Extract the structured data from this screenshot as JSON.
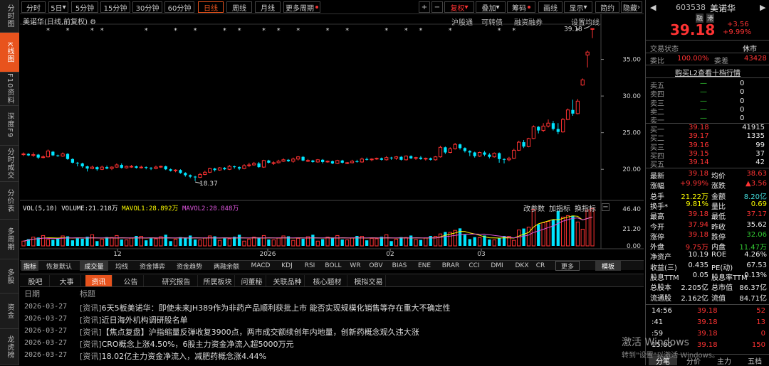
{
  "stock": {
    "code": "603538",
    "name": "美诺华",
    "tags": [
      "融",
      "港"
    ],
    "price": "39.18",
    "change": "+3.56",
    "pct": "+9.99%",
    "status_label": "交易状态",
    "status": "休市"
  },
  "sidebar": [
    {
      "label": "分时图",
      "active": false
    },
    {
      "label": "K线图",
      "active": true
    },
    {
      "label": "F10资料",
      "active": false
    },
    {
      "label": "深度F9",
      "active": false
    },
    {
      "label": "分时成交",
      "active": false
    },
    {
      "label": "分价表",
      "active": false
    },
    {
      "label": "多周期",
      "active": false
    },
    {
      "label": "多股",
      "active": false
    },
    {
      "label": "资金",
      "active": false
    },
    {
      "label": "龙虎榜",
      "active": false
    }
  ],
  "toolbar": {
    "periods": [
      "分时",
      "5日",
      "5分钟",
      "15分钟",
      "30分钟",
      "60分钟",
      "日线",
      "周线",
      "月线",
      "更多周期"
    ],
    "active_period": "日线",
    "plus": "+",
    "minus": "−",
    "fq": "复权",
    "overlay": "叠加",
    "chips": "筹码",
    "draw": "画线",
    "display": "显示",
    "concise": "简约",
    "hide": "隐藏"
  },
  "chart": {
    "title_name": "美诺华",
    "title_sub": "(日线,前复权)",
    "links": [
      "沪股通",
      "可转债",
      "融资融券",
      "设置均线"
    ],
    "price_axis": [
      "35.00",
      "30.00",
      "25.00",
      "20.00"
    ],
    "high_label": "39.18",
    "low_label": "18.37",
    "vol_axis": [
      "46.40",
      "21.20",
      "0.00"
    ],
    "vol_x_labels": [
      "12",
      "2026",
      "02",
      "03"
    ],
    "vol_header": {
      "label": "VOL(5,10)",
      "vol": "VOLUME:21.218万",
      "ma1": "MAVOL1:28.892万",
      "ma2": "MAVOL2:28.848万"
    },
    "vol_buttons": [
      "改参数",
      "加指标",
      "换指标"
    ]
  },
  "chart_data": {
    "type": "candlestick",
    "title": "美诺华(日线,前复权)",
    "y_range": [
      17.5,
      40
    ],
    "candles": [
      [
        22.0,
        22.1,
        21.8,
        22.3
      ],
      [
        22.1,
        21.9,
        21.8,
        22.2
      ],
      [
        21.9,
        22.0,
        21.7,
        22.3
      ],
      [
        22.0,
        21.6,
        21.4,
        22.1
      ],
      [
        21.6,
        21.7,
        21.5,
        21.9
      ],
      [
        21.7,
        22.5,
        21.6,
        22.7
      ],
      [
        22.4,
        21.9,
        21.8,
        22.5
      ],
      [
        21.9,
        21.8,
        21.7,
        22.0
      ],
      [
        21.8,
        22.1,
        21.7,
        22.3
      ],
      [
        22.1,
        21.4,
        21.3,
        22.2
      ],
      [
        21.4,
        20.9,
        20.8,
        21.5
      ],
      [
        20.9,
        20.8,
        20.4,
        21.0
      ],
      [
        20.8,
        20.4,
        20.2,
        20.9
      ],
      [
        20.4,
        20.1,
        19.7,
        20.5
      ],
      [
        20.1,
        20.3,
        20.0,
        20.5
      ],
      [
        20.3,
        20.0,
        19.8,
        20.4
      ],
      [
        20.0,
        20.3,
        19.9,
        20.5
      ],
      [
        20.3,
        20.1,
        20.0,
        20.5
      ],
      [
        20.1,
        20.3,
        19.9,
        20.4
      ],
      [
        20.3,
        20.6,
        20.2,
        20.8
      ],
      [
        20.6,
        20.2,
        20.1,
        20.8
      ],
      [
        20.2,
        20.4,
        20.1,
        20.5
      ],
      [
        20.4,
        20.4,
        20.2,
        20.6
      ],
      [
        20.4,
        20.2,
        20.1,
        20.5
      ],
      [
        20.2,
        20.3,
        20.1,
        20.5
      ],
      [
        20.3,
        20.2,
        20.0,
        20.4
      ],
      [
        20.2,
        20.1,
        19.9,
        20.3
      ],
      [
        20.1,
        20.3,
        20.0,
        20.5
      ],
      [
        20.3,
        20.4,
        20.2,
        20.5
      ],
      [
        20.4,
        20.0,
        19.9,
        20.5
      ],
      [
        20.0,
        19.8,
        19.7,
        20.1
      ],
      [
        19.8,
        19.9,
        19.6,
        20.0
      ],
      [
        19.9,
        19.5,
        19.4,
        20.0
      ],
      [
        19.5,
        19.2,
        19.0,
        19.6
      ],
      [
        19.2,
        19.0,
        18.8,
        19.3
      ],
      [
        19.0,
        18.9,
        18.4,
        19.1
      ],
      [
        18.9,
        19.3,
        18.8,
        19.5
      ],
      [
        19.3,
        19.6,
        19.2,
        19.8
      ],
      [
        19.6,
        20.1,
        19.5,
        20.2
      ],
      [
        20.1,
        19.9,
        19.7,
        20.2
      ],
      [
        19.9,
        20.2,
        19.8,
        20.3
      ],
      [
        20.2,
        20.0,
        19.9,
        20.3
      ],
      [
        20.0,
        20.4,
        19.9,
        20.6
      ],
      [
        20.4,
        20.3,
        20.1,
        20.5
      ],
      [
        20.3,
        20.1,
        19.9,
        20.4
      ],
      [
        20.1,
        20.5,
        20.0,
        20.7
      ],
      [
        20.5,
        20.6,
        20.3,
        20.9
      ],
      [
        20.6,
        20.8,
        20.5,
        21.0
      ],
      [
        20.8,
        20.3,
        20.2,
        21.0
      ],
      [
        20.3,
        21.2,
        20.2,
        21.3
      ],
      [
        21.2,
        20.9,
        20.8,
        21.3
      ],
      [
        20.9,
        20.9,
        20.6,
        21.1
      ],
      [
        20.9,
        21.1,
        20.8,
        21.3
      ],
      [
        21.1,
        21.3,
        21.0,
        21.5
      ],
      [
        21.3,
        21.1,
        21.0,
        21.4
      ],
      [
        21.1,
        21.4,
        20.9,
        21.6
      ],
      [
        21.4,
        21.7,
        21.2,
        21.8
      ],
      [
        21.7,
        21.2,
        21.1,
        21.8
      ],
      [
        21.2,
        21.2,
        21.0,
        21.4
      ],
      [
        21.2,
        21.0,
        20.9,
        21.3
      ],
      [
        21.0,
        21.3,
        20.9,
        21.4
      ],
      [
        21.3,
        21.0,
        20.8,
        21.4
      ],
      [
        21.0,
        21.1,
        20.9,
        21.2
      ],
      [
        21.1,
        20.8,
        20.7,
        21.2
      ],
      [
        20.8,
        21.2,
        20.7,
        21.3
      ],
      [
        21.2,
        20.9,
        20.8,
        21.3
      ],
      [
        20.9,
        20.9,
        20.7,
        21.0
      ],
      [
        20.9,
        21.1,
        20.8,
        21.3
      ],
      [
        21.1,
        21.0,
        20.9,
        21.3
      ],
      [
        21.0,
        21.4,
        20.9,
        21.6
      ],
      [
        21.4,
        21.3,
        21.2,
        21.6
      ],
      [
        21.3,
        21.4,
        21.1,
        21.5
      ],
      [
        21.4,
        21.5,
        21.3,
        21.6
      ],
      [
        21.5,
        21.3,
        21.2,
        21.6
      ],
      [
        21.3,
        21.6,
        21.2,
        21.8
      ],
      [
        21.6,
        21.5,
        21.3,
        21.7
      ],
      [
        21.5,
        21.7,
        21.3,
        21.8
      ],
      [
        21.7,
        21.3,
        21.2,
        21.8
      ],
      [
        21.3,
        21.8,
        21.2,
        21.9
      ],
      [
        21.8,
        21.5,
        21.4,
        21.9
      ],
      [
        21.5,
        21.6,
        21.3,
        21.7
      ],
      [
        21.6,
        21.4,
        21.3,
        21.8
      ],
      [
        21.4,
        21.5,
        21.2,
        21.6
      ],
      [
        21.5,
        21.3,
        21.2,
        21.6
      ],
      [
        21.3,
        21.7,
        21.2,
        21.8
      ],
      [
        21.7,
        23.0,
        21.6,
        23.2
      ],
      [
        23.0,
        22.3,
        22.1,
        23.1
      ],
      [
        22.3,
        22.8,
        22.2,
        23.0
      ],
      [
        22.8,
        23.4,
        22.7,
        23.6
      ],
      [
        23.4,
        22.9,
        22.7,
        23.5
      ],
      [
        22.9,
        22.5,
        22.3,
        23.0
      ],
      [
        22.5,
        22.3,
        21.8,
        22.6
      ],
      [
        22.3,
        21.8,
        21.6,
        22.4
      ],
      [
        21.8,
        22.3,
        21.7,
        22.4
      ],
      [
        22.3,
        22.0,
        21.8,
        22.5
      ],
      [
        22.0,
        21.7,
        21.5,
        22.2
      ],
      [
        21.7,
        22.2,
        21.6,
        22.3
      ],
      [
        22.2,
        21.4,
        20.9,
        22.3
      ],
      [
        21.4,
        21.3,
        20.8,
        21.5
      ],
      [
        21.3,
        21.5,
        21.1,
        21.7
      ],
      [
        21.5,
        22.6,
        21.4,
        22.8
      ],
      [
        22.6,
        23.7,
        22.5,
        23.9
      ],
      [
        23.7,
        23.1,
        22.9,
        24.0
      ],
      [
        23.1,
        24.2,
        23.0,
        24.3
      ],
      [
        24.2,
        25.8,
        24.1,
        26.0
      ],
      [
        25.8,
        25.3,
        24.9,
        25.9
      ],
      [
        25.3,
        25.9,
        25.1,
        26.3
      ],
      [
        25.9,
        26.3,
        25.7,
        26.8
      ],
      [
        26.3,
        25.5,
        25.3,
        26.6
      ],
      [
        25.5,
        25.1,
        24.8,
        26.3
      ],
      [
        25.1,
        26.8,
        25.0,
        27.0
      ],
      [
        26.8,
        28.1,
        26.7,
        28.3
      ],
      [
        28.1,
        27.6,
        27.3,
        29.5
      ],
      [
        27.6,
        29.3,
        27.5,
        29.6
      ],
      [
        31.5,
        32.2,
        31.4,
        32.4
      ],
      [
        35.6,
        36.0,
        33.9,
        36.2
      ],
      [
        39.1,
        39.2,
        37.9,
        39.2
      ]
    ]
  },
  "indicators": {
    "items": [
      "指标",
      "恢复默认",
      "成交量",
      "均线",
      "资金博弈",
      "资金趋势",
      "两融余额",
      "MACD",
      "KDJ",
      "RSI",
      "BOLL",
      "WR",
      "OBV",
      "BIAS",
      "ENE",
      "BRAR",
      "CCI",
      "DMI",
      "DKX",
      "CR",
      "更多",
      "模板"
    ],
    "active": "成交量"
  },
  "news": {
    "tabs": [
      "股吧",
      "大事",
      "资讯",
      "公告",
      "研究报告",
      "所属板块",
      "问董秘",
      "关联品种",
      "核心题材",
      "模拟交易"
    ],
    "active": "资讯",
    "col_date": "日期",
    "col_title": "标题",
    "items": [
      {
        "date": "2026-03-27",
        "tag": "[资讯]",
        "title": "6天5板美诺华：即使未来JH389作为非药产品顺利获批上市 能否实现规模化销售等存在重大不确定性"
      },
      {
        "date": "2026-03-27",
        "tag": "[资讯]",
        "title": "近日海外机构调研股名单"
      },
      {
        "date": "2026-03-27",
        "tag": "[资讯]",
        "title": "【焦点复盘】沪指缩量反弹收复3900点，两市成交额续创年内地量，创新药概念观久违大涨"
      },
      {
        "date": "2026-03-27",
        "tag": "[资讯]",
        "title": "CRO概念上涨4.50%，6股主力资金净流入超5000万元"
      },
      {
        "date": "2026-03-27",
        "tag": "[资讯]",
        "title": "18.02亿主力资金净流入，减肥药概念涨4.44%"
      }
    ]
  },
  "orderbook": {
    "webi_label": "委比",
    "webi": "100.00%",
    "weicha_label": "委差",
    "weicha": "43428",
    "l2_link": "购买L2查看十档行情",
    "sells": [
      {
        "l": "卖五",
        "p": "—",
        "v": "0"
      },
      {
        "l": "卖四",
        "p": "—",
        "v": "0"
      },
      {
        "l": "卖三",
        "p": "—",
        "v": "0"
      },
      {
        "l": "卖二",
        "p": "—",
        "v": "0"
      },
      {
        "l": "卖一",
        "p": "—",
        "v": "0"
      }
    ],
    "buys": [
      {
        "l": "买一",
        "p": "39.18",
        "v": "41915"
      },
      {
        "l": "买二",
        "p": "39.17",
        "v": "1335"
      },
      {
        "l": "买三",
        "p": "39.16",
        "v": "99"
      },
      {
        "l": "买四",
        "p": "39.15",
        "v": "37"
      },
      {
        "l": "买五",
        "p": "39.14",
        "v": "42"
      }
    ]
  },
  "stats": [
    {
      "l1": "最新",
      "v1": "39.18",
      "c1": "red",
      "l2": "均价",
      "v2": "38.63",
      "c2": "red"
    },
    {
      "l1": "涨幅",
      "v1": "+9.99%",
      "c1": "red",
      "l2": "涨跌",
      "v2": "▲3.56",
      "c2": "red"
    },
    {
      "l1": "总手",
      "v1": "21.22万",
      "c1": "yel",
      "l2": "金额",
      "v2": "8.20亿",
      "c2": "cyn"
    },
    {
      "l1": "换手*",
      "v1": "9.81%",
      "c1": "yel",
      "l2": "量比",
      "v2": "0.69",
      "c2": "yel"
    },
    {
      "l1": "最高",
      "v1": "39.18",
      "c1": "red",
      "l2": "最低",
      "v2": "37.17",
      "c2": "red"
    },
    {
      "l1": "今开",
      "v1": "37.94",
      "c1": "red",
      "l2": "昨收",
      "v2": "35.62",
      "c2": "wht"
    },
    {
      "l1": "涨停",
      "v1": "39.18",
      "c1": "red",
      "l2": "跌停",
      "v2": "32.06",
      "c2": "grn"
    },
    {
      "l1": "外盘",
      "v1": "9.75万",
      "c1": "red",
      "l2": "内盘",
      "v2": "11.47万",
      "c2": "grn"
    },
    {
      "l1": "净资产",
      "v1": "10.19",
      "c1": "wht",
      "l2": "ROE",
      "v2": "4.26%",
      "c2": "wht"
    },
    {
      "l1": "收益(三)",
      "v1": "0.435",
      "c1": "wht",
      "l2": "PE(动)",
      "v2": "67.53",
      "c2": "wht"
    },
    {
      "l1": "股息TTM",
      "v1": "0.05",
      "c1": "wht",
      "l2": "股息率TTM",
      "v2": "0.13%",
      "c2": "wht"
    },
    {
      "l1": "总股本",
      "v1": "2.205亿",
      "c1": "wht",
      "l2": "总市值",
      "v2": "86.37亿",
      "c2": "wht"
    },
    {
      "l1": "流通股",
      "v1": "2.162亿",
      "c1": "wht",
      "l2": "流值",
      "v2": "84.71亿",
      "c2": "wht"
    }
  ],
  "ticks": [
    {
      "t": "14:56",
      "p": "39.18",
      "v": "52"
    },
    {
      "t": ":41",
      "p": "39.18",
      "v": "13"
    },
    {
      "t": ":59",
      "p": "39.18",
      "v": "0"
    },
    {
      "t": "15:00",
      "p": "39.18",
      "v": "150"
    }
  ],
  "bottom_tabs": [
    "分笔",
    "分价",
    "主力",
    "五档"
  ],
  "watermark": {
    "line1": "激活 Windows",
    "line2": "转到\"设置\"以激活 Windows。"
  }
}
